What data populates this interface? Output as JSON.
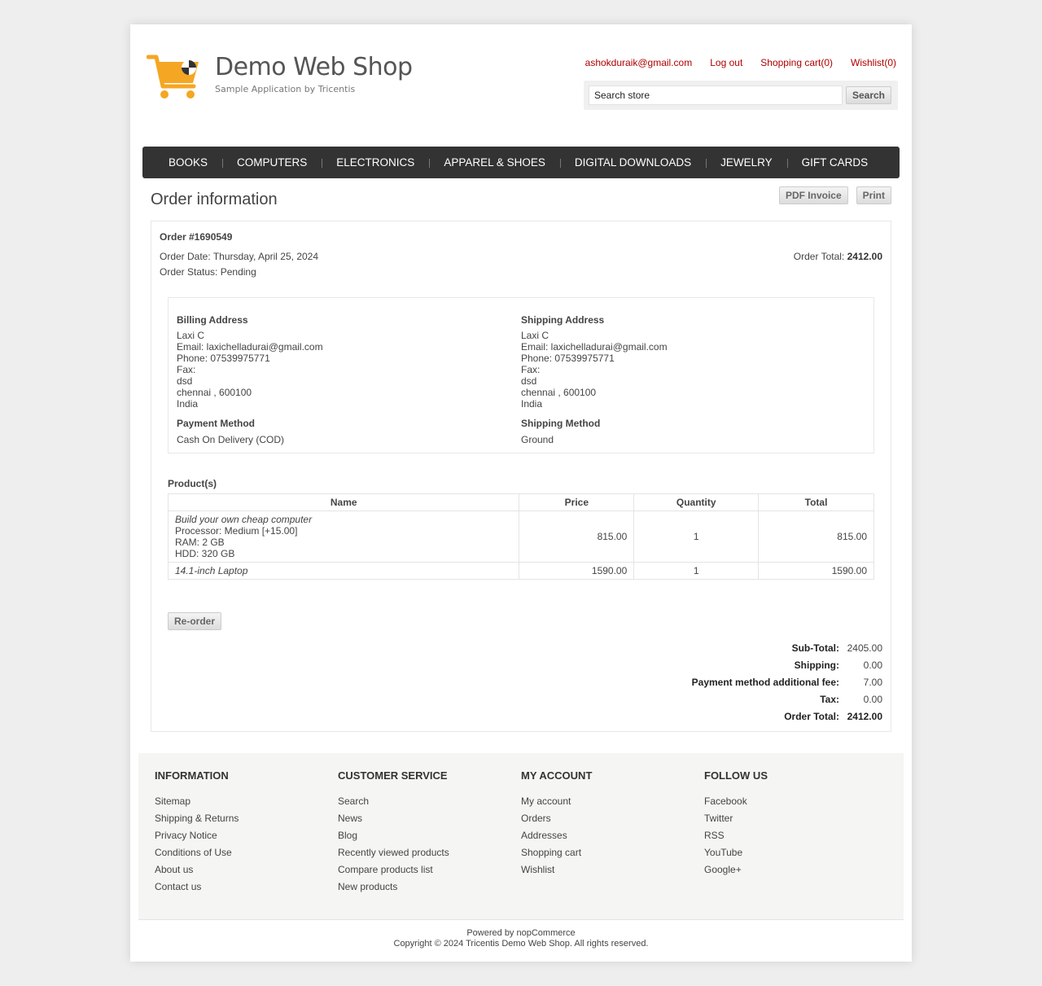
{
  "brand": {
    "title": "Demo Web Shop",
    "subtitle": "Sample Application by Tricentis",
    "logo_color": "#f5a623"
  },
  "header": {
    "links": [
      "ashokduraik@gmail.com",
      "Log out",
      "Shopping cart(0)",
      "Wishlist(0)"
    ],
    "search_value": "Search store",
    "search_button": "Search"
  },
  "nav": [
    "BOOKS",
    "COMPUTERS",
    "ELECTRONICS",
    "APPAREL & SHOES",
    "DIGITAL DOWNLOADS",
    "JEWELRY",
    "GIFT CARDS"
  ],
  "page": {
    "title": "Order information",
    "pdf_button": "PDF Invoice",
    "print_button": "Print"
  },
  "order": {
    "number": "Order #1690549",
    "date_label": "Order Date:",
    "date": "Thursday, April 25, 2024",
    "status_label": "Order Status:",
    "status": "Pending",
    "total_label": "Order Total:",
    "total": "2412.00"
  },
  "billing": {
    "title": "Billing Address",
    "name": "Laxi C",
    "email": "Email: laxichelladurai@gmail.com",
    "phone": "Phone: 07539975771",
    "fax": "Fax:",
    "street": "dsd",
    "city": "chennai , 600100",
    "country": "India",
    "method_title": "Payment Method",
    "method": "Cash On Delivery (COD)"
  },
  "shipping": {
    "title": "Shipping Address",
    "name": "Laxi C",
    "email": "Email: laxichelladurai@gmail.com",
    "phone": "Phone: 07539975771",
    "fax": "Fax:",
    "street": "dsd",
    "city": "chennai , 600100",
    "country": "India",
    "method_title": "Shipping Method",
    "method": "Ground"
  },
  "products": {
    "title": "Product(s)",
    "headers": [
      "Name",
      "Price",
      "Quantity",
      "Total"
    ],
    "rows": [
      {
        "name": "Build your own cheap computer",
        "attrs": [
          "Processor: Medium [+15.00]",
          "RAM: 2 GB",
          "HDD: 320 GB"
        ],
        "price": "815.00",
        "qty": "1",
        "total": "815.00"
      },
      {
        "name": "14.1-inch Laptop",
        "attrs": [],
        "price": "1590.00",
        "qty": "1",
        "total": "1590.00"
      }
    ],
    "reorder_button": "Re-order"
  },
  "totals": [
    {
      "label": "Sub-Total:",
      "value": "2405.00"
    },
    {
      "label": "Shipping:",
      "value": "0.00"
    },
    {
      "label": "Payment method additional fee:",
      "value": "7.00"
    },
    {
      "label": "Tax:",
      "value": "0.00"
    },
    {
      "label": "Order Total:",
      "value": "2412.00"
    }
  ],
  "footer": {
    "columns": [
      {
        "title": "Information",
        "links": [
          "Sitemap",
          "Shipping & Returns",
          "Privacy Notice",
          "Conditions of Use",
          "About us",
          "Contact us"
        ]
      },
      {
        "title": "Customer service",
        "links": [
          "Search",
          "News",
          "Blog",
          "Recently viewed products",
          "Compare products list",
          "New products"
        ]
      },
      {
        "title": "My account",
        "links": [
          "My account",
          "Orders",
          "Addresses",
          "Shopping cart",
          "Wishlist"
        ]
      },
      {
        "title": "Follow us",
        "links": [
          "Facebook",
          "Twitter",
          "RSS",
          "YouTube",
          "Google+"
        ]
      }
    ],
    "powered": "Powered by nopCommerce",
    "copyright": "Copyright © 2024 Tricentis Demo Web Shop. All rights reserved."
  }
}
